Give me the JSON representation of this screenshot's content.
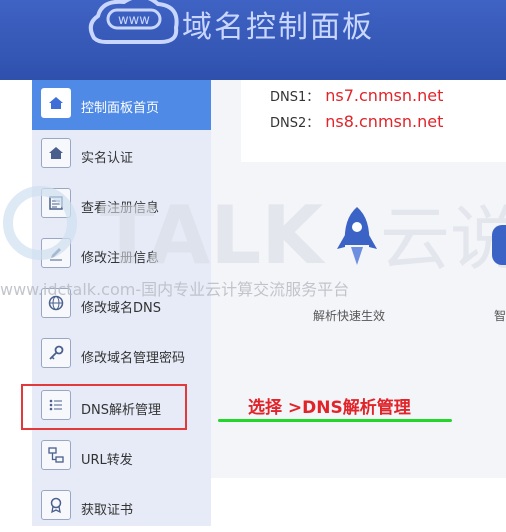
{
  "header": {
    "logo_text": "www",
    "title": "域名控制面板"
  },
  "sidebar": {
    "items": [
      {
        "label": "控制面板首页",
        "icon": "home-icon",
        "active": true
      },
      {
        "label": "实名认证",
        "icon": "home-icon",
        "active": false
      },
      {
        "label": "查看注册信息",
        "icon": "document-icon",
        "active": false
      },
      {
        "label": "修改注册信息",
        "icon": "edit-icon",
        "active": false
      },
      {
        "label": "修改域名DNS",
        "icon": "globe-icon",
        "active": false
      },
      {
        "label": "修改域名管理密码",
        "icon": "key-icon",
        "active": false
      },
      {
        "label": "DNS解析管理",
        "icon": "list-icon",
        "active": false
      },
      {
        "label": "URL转发",
        "icon": "network-icon",
        "active": false
      },
      {
        "label": "获取证书",
        "icon": "certificate-icon",
        "active": false
      }
    ]
  },
  "dns": {
    "dns1_label": "DNS1：",
    "dns1_value": "ns7.cnmsn.net",
    "dns2_label": "DNS2：",
    "dns2_value": "ns8.cnmsn.net"
  },
  "features": {
    "rocket_label": "解析快速生效",
    "edge_label": "智"
  },
  "watermark": {
    "text": "www.idctalk.com-国内专业云计算交流服务平台"
  },
  "annotation": {
    "text": "选择 >DNS解析管理"
  },
  "colors": {
    "header_blue": "#2f50ad",
    "sidebar_bg": "#e6ebf7",
    "active_blue": "#4f8be6",
    "dns_red": "#e0242a",
    "highlight_red": "#e23a3a",
    "underline_green": "#22d62a"
  }
}
